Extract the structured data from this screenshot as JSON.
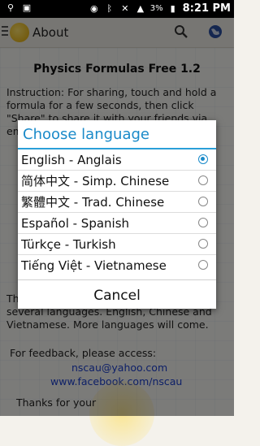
{
  "status": {
    "battery": "3%",
    "time": "8:21 PM"
  },
  "appbar": {
    "title": "About"
  },
  "about": {
    "title": "Physics Formulas Free 1.2",
    "instructions": "Instruction: For sharing, touch and hold a formula for a few seconds, then click \"Share\" to share it with your friends via email.",
    "languages_note": "This app supports multiple languages in several languages. English, Chinese and Vietnamese. More languages will come.",
    "feedback_label": "For feedback, please access:",
    "email": "nscau@yahoo.com",
    "facebook": "www.facebook.com/nscau",
    "thanks": "Thanks for your"
  },
  "dialog": {
    "title": "Choose language",
    "options": [
      {
        "label": "English - Anglais",
        "selected": true
      },
      {
        "label": "简体中文 - Simp. Chinese",
        "selected": false
      },
      {
        "label": "繁體中文 - Trad. Chinese",
        "selected": false
      },
      {
        "label": "Español - Spanish",
        "selected": false
      },
      {
        "label": "Türkçe - Turkish",
        "selected": false
      },
      {
        "label": "Tiếng Việt - Vietnamese",
        "selected": false
      }
    ],
    "cancel_label": "Cancel"
  }
}
